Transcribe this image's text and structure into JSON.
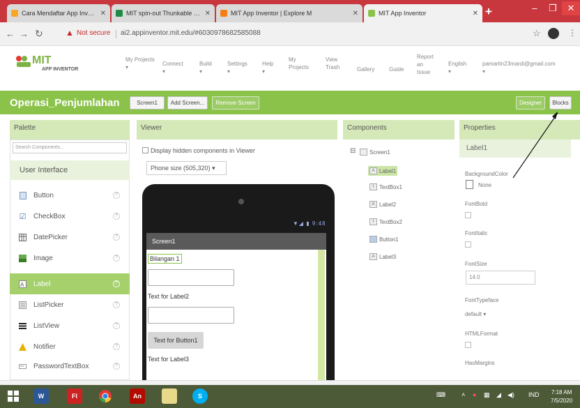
{
  "browser": {
    "tabs": [
      {
        "title": "Cara Mendaftar App Inventor",
        "favicon_color": "#f9a825"
      },
      {
        "title": "MIT spin-out Thunkable hop",
        "favicon_color": "#1f8a43"
      },
      {
        "title": "MIT App Inventor | Explore M",
        "favicon_color": "#f57f17"
      },
      {
        "title": "MIT App Inventor",
        "favicon_color": "#8bc34a"
      }
    ],
    "not_secure": "Not secure",
    "url": "ai2.appinventor.mit.edu/#6030978682585088",
    "window_controls": [
      "minimize-icon",
      "maximize-icon",
      "close-icon"
    ]
  },
  "app_header": {
    "logo_text": "MIT",
    "logo_sub": "APP INVENTOR",
    "menus": [
      {
        "label": "My Projects",
        "has_dropdown": true
      },
      {
        "label": "Connect",
        "has_dropdown": true
      },
      {
        "label": "Build",
        "has_dropdown": true
      },
      {
        "label": "Settings",
        "has_dropdown": true
      },
      {
        "label": "Help",
        "has_dropdown": true
      },
      {
        "label": "My Projects",
        "has_dropdown": false
      },
      {
        "label": "View Trash",
        "has_dropdown": false
      },
      {
        "label": "Gallery",
        "has_dropdown": false
      },
      {
        "label": "Guide",
        "has_dropdown": false
      },
      {
        "label": "Report an Issue",
        "has_dropdown": false
      },
      {
        "label": "English",
        "has_dropdown": true
      },
      {
        "label": "pamartin23mardi@gmail.com",
        "has_dropdown": true
      }
    ]
  },
  "toolbar": {
    "project_name": "Operasi_Penjumlahan",
    "screen_dropdown": "Screen1",
    "add_screen": "Add Screen...",
    "remove_screen": "Remove Screen",
    "designer": "Designer",
    "blocks": "Blocks"
  },
  "palette": {
    "title": "Palette",
    "search_placeholder": "Search Components...",
    "category": "User Interface",
    "items": [
      {
        "label": "Button",
        "icon": "button-icon",
        "selected": false
      },
      {
        "label": "CheckBox",
        "icon": "checkbox-icon",
        "selected": false
      },
      {
        "label": "DatePicker",
        "icon": "datepicker-icon",
        "selected": false
      },
      {
        "label": "Image",
        "icon": "image-icon",
        "selected": false
      },
      {
        "label": "Label",
        "icon": "label-icon",
        "selected": true
      },
      {
        "label": "ListPicker",
        "icon": "listpicker-icon",
        "selected": false
      },
      {
        "label": "ListView",
        "icon": "listview-icon",
        "selected": false
      },
      {
        "label": "Notifier",
        "icon": "notifier-icon",
        "selected": false
      },
      {
        "label": "PasswordTextBox",
        "icon": "passwordtextbox-icon",
        "selected": false
      }
    ],
    "help_glyph": "?"
  },
  "viewer": {
    "title": "Viewer",
    "hidden_components_label": "Display hidden components in Viewer",
    "phone_size": "Phone size (505,320)",
    "status_time": "9:48",
    "screen_title": "Screen1",
    "label1": "Bilangan 1",
    "label2": "Text for Label2",
    "button1": "Text for Button1",
    "label3": "Text for Label3"
  },
  "components": {
    "title": "Components",
    "root": "Screen1",
    "children": [
      {
        "label": "Label1",
        "selected": true
      },
      {
        "label": "TextBox1",
        "selected": false
      },
      {
        "label": "Label2",
        "selected": false
      },
      {
        "label": "TextBox2",
        "selected": false
      },
      {
        "label": "Button1",
        "selected": false
      },
      {
        "label": "Label3",
        "selected": false
      }
    ]
  },
  "properties": {
    "title": "Properties",
    "component": "Label1",
    "background_color_label": "BackgroundColor",
    "background_color_value": "None",
    "font_bold_label": "FontBold",
    "font_italic_label": "FontItalic",
    "font_size_label": "FontSize",
    "font_size_value": "14.0",
    "font_typeface_label": "FontTypeface",
    "font_typeface_value": "default",
    "html_format_label": "HTMLFormat",
    "has_margins_label": "HasMargins"
  },
  "taskbar": {
    "apps": [
      {
        "name": "windows-start-icon",
        "color": "#3a3a3a"
      },
      {
        "name": "word-icon",
        "color": "#2b5797"
      },
      {
        "name": "flash-icon",
        "color": "#cc2222"
      },
      {
        "name": "chrome-icon",
        "color": "#f2f2f2"
      },
      {
        "name": "acrobat-icon",
        "color": "#b30b00"
      },
      {
        "name": "notepad-icon",
        "color": "#e8d88a"
      },
      {
        "name": "skype-icon",
        "color": "#00aff0"
      }
    ],
    "language": "IND",
    "time": "7:18 AM",
    "date": "7/5/2020"
  },
  "colors": {
    "tab_strip": "#c9373e",
    "accent_green": "#8bc34a",
    "pane_header": "#d5e8b8",
    "selected_item": "#a5d06c",
    "taskbar": "#4d5a38"
  }
}
